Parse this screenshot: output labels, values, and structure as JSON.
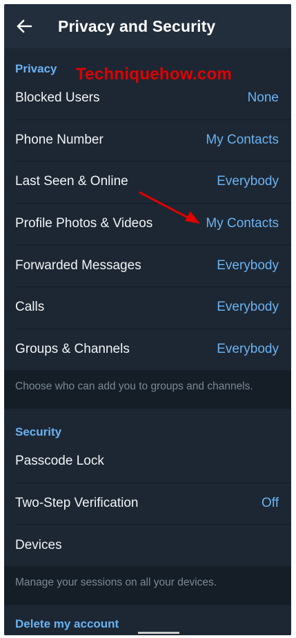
{
  "header": {
    "title": "Privacy and Security"
  },
  "watermark": "Techniquehow.com",
  "privacy": {
    "header": "Privacy",
    "items": [
      {
        "label": "Blocked Users",
        "value": "None"
      },
      {
        "label": "Phone Number",
        "value": "My Contacts"
      },
      {
        "label": "Last Seen & Online",
        "value": "Everybody"
      },
      {
        "label": "Profile Photos & Videos",
        "value": "My Contacts"
      },
      {
        "label": "Forwarded Messages",
        "value": "Everybody"
      },
      {
        "label": "Calls",
        "value": "Everybody"
      },
      {
        "label": "Groups & Channels",
        "value": "Everybody"
      }
    ],
    "hint": "Choose who can add you to groups and channels."
  },
  "security": {
    "header": "Security",
    "items": [
      {
        "label": "Passcode Lock",
        "value": ""
      },
      {
        "label": "Two-Step Verification",
        "value": "Off"
      },
      {
        "label": "Devices",
        "value": ""
      }
    ],
    "hint": "Manage your sessions on all your devices."
  },
  "delete_account": {
    "header": "Delete my account"
  },
  "colors": {
    "background": "#1c2733",
    "appbar": "#232e3c",
    "accent": "#6ab3f3",
    "annotation": "#e00000"
  }
}
